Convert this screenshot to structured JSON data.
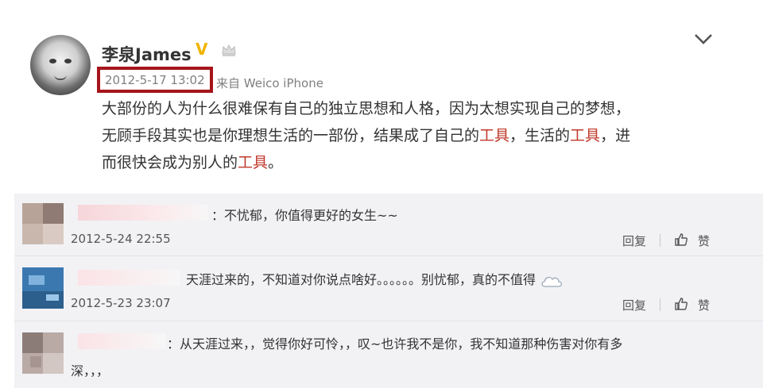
{
  "post": {
    "username": "李泉James",
    "verified_badge": "V",
    "timestamp": "2012-5-17 13:02",
    "source": "来自 Weico iPhone",
    "content": [
      [
        {
          "t": "大部份的人为什么很难保有自己的独立思想和人格，因为太想实现自己的梦想，"
        }
      ],
      [
        {
          "t": "无顾手段其实也是你理想生活的一部份，结果成了自己的"
        },
        {
          "t": "工具",
          "hl": true
        },
        {
          "t": "，生活的"
        },
        {
          "t": "工具",
          "hl": true
        },
        {
          "t": "，进"
        }
      ],
      [
        {
          "t": "而很快会成为别人的"
        },
        {
          "t": "工具",
          "hl": true
        },
        {
          "t": "。"
        }
      ]
    ],
    "icons": {
      "crown": "crown-icon",
      "expand": "chevron-down-icon",
      "avatar": "baby-photo-avatar"
    }
  },
  "comments": [
    {
      "text": "：不忧郁，你值得更好的女生~~",
      "time": "2012-5-24 22:55",
      "reply": "回复",
      "like": "赞"
    },
    {
      "text": "天涯过来的，不知道对你说点啥好。。。。。。别忧郁，真的不值得",
      "time": "2012-5-23 23:07",
      "reply": "回复",
      "like": "赞"
    },
    {
      "text_line1": "：从天涯过来，，觉得你好可怜，，叹~也许我不是你，我不知道那种伤害对你有多",
      "text_line2": "深，，，"
    }
  ],
  "colors": {
    "highlight": "#c0392b",
    "timestamp_box": "#a6151c",
    "vip": "#f0b400",
    "comment_bg": "#f2f2f5"
  }
}
